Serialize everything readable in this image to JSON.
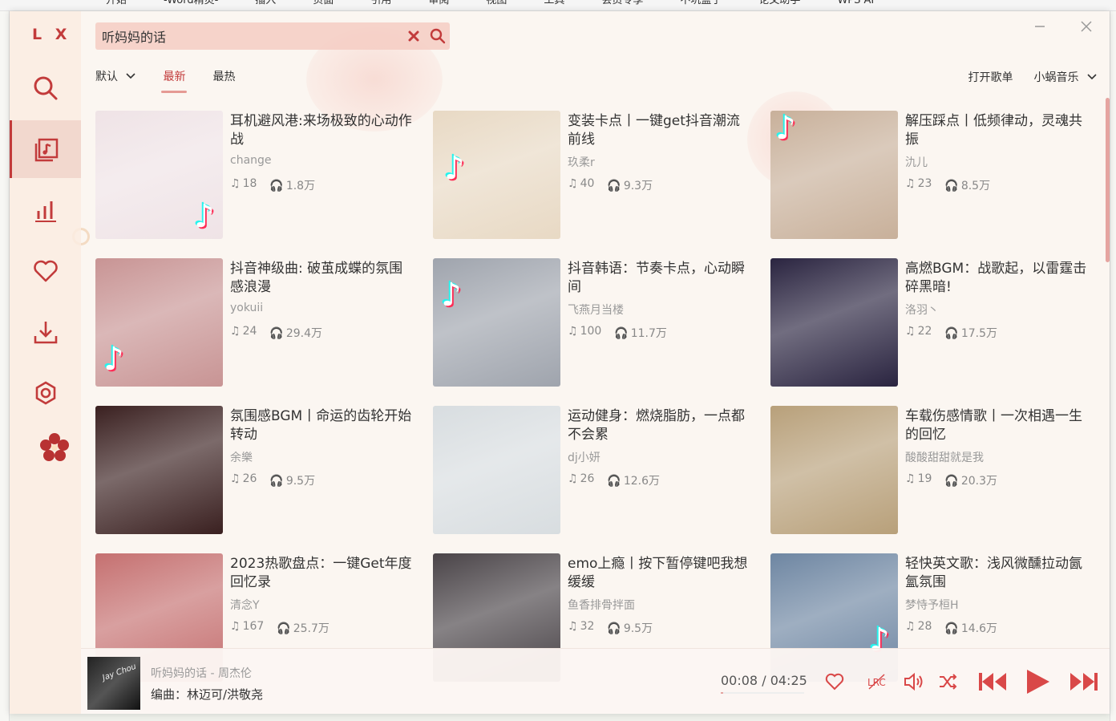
{
  "background_ribbon": [
    "开始",
    "-Word精灵-",
    "插入",
    "页面",
    "引用",
    "审阅",
    "视图",
    "工具",
    "会员专享",
    "不坑盒子",
    "论文助手",
    "WPS AI"
  ],
  "app": {
    "logo": "L X",
    "search": {
      "value": "听妈妈的话"
    },
    "tabs": [
      {
        "label": "默认",
        "has_dropdown": true
      },
      {
        "label": "最新",
        "active": true
      },
      {
        "label": "最热"
      }
    ],
    "open_playlist": "打开歌单",
    "source_select": "小蜗音乐",
    "sidebar": [
      {
        "icon": "search-icon"
      },
      {
        "icon": "music-list-icon",
        "active": true
      },
      {
        "icon": "chart-bars-icon"
      },
      {
        "icon": "heart-icon"
      },
      {
        "icon": "download-icon"
      },
      {
        "icon": "settings-icon"
      }
    ],
    "playlists": [
      {
        "title": "耳机避风港:来场极致的心动作战",
        "author": "change",
        "songs": "18",
        "plays": "1.8万",
        "cover": "#efe3e6"
      },
      {
        "title": "变装卡点丨一键get抖音潮流前线",
        "author": "玖柔r",
        "songs": "40",
        "plays": "9.3万",
        "cover": "#e8d9c4"
      },
      {
        "title": "解压踩点丨低频律动，灵魂共振",
        "author": "氿儿",
        "songs": "23",
        "plays": "8.5万",
        "cover": "#c8b09a"
      },
      {
        "title": "抖音神级曲: 破茧成蝶的氛围感浪漫",
        "author": "yokuii",
        "songs": "24",
        "plays": "29.4万",
        "cover": "#c89494"
      },
      {
        "title": "抖音韩语：节奏卡点，心动瞬间",
        "author": "飞燕月当楼",
        "songs": "100",
        "plays": "11.7万",
        "cover": "#9fa4ad"
      },
      {
        "title": "高燃BGM：战歌起，以雷霆击碎黑暗!",
        "author": "洛羽丶",
        "songs": "22",
        "plays": "17.5万",
        "cover": "#2a2440"
      },
      {
        "title": "氛围感BGM丨命运的齿轮开始转动",
        "author": "余樂",
        "songs": "26",
        "plays": "9.5万",
        "cover": "#3a2020"
      },
      {
        "title": "运动健身：燃烧脂肪，一点都不会累",
        "author": "dj小妍",
        "songs": "26",
        "plays": "12.6万",
        "cover": "#d8dde0"
      },
      {
        "title": "车载伤感情歌丨一次相遇一生的回忆",
        "author": "酸酸甜甜就是我",
        "songs": "19",
        "plays": "20.3万",
        "cover": "#b8a07a"
      },
      {
        "title": "2023热歌盘点：一键Get年度回忆录",
        "author": "清念Y",
        "songs": "167",
        "plays": "25.7万",
        "cover": "#c57070"
      },
      {
        "title": "emo上瘾丨按下暂停键吧我想缓缓",
        "author": "鱼香排骨拌面",
        "songs": "32",
        "plays": "9.5万",
        "cover": "#4a4448"
      },
      {
        "title": "轻快英文歌：浅风微醺拉动氤氳氛围",
        "author": "梦恃予桓H",
        "songs": "28",
        "plays": "14.6万",
        "cover": "#6e86a2"
      }
    ],
    "player": {
      "title": "听妈妈的话 - 周杰伦",
      "subtitle": "编曲：林迈可/洪敬尧",
      "current": "00:08",
      "separator": "/",
      "total": "04:25",
      "progress_fraction": 0.03,
      "cover_caption": "Jay Chou"
    },
    "accent": "#c23b3b"
  }
}
